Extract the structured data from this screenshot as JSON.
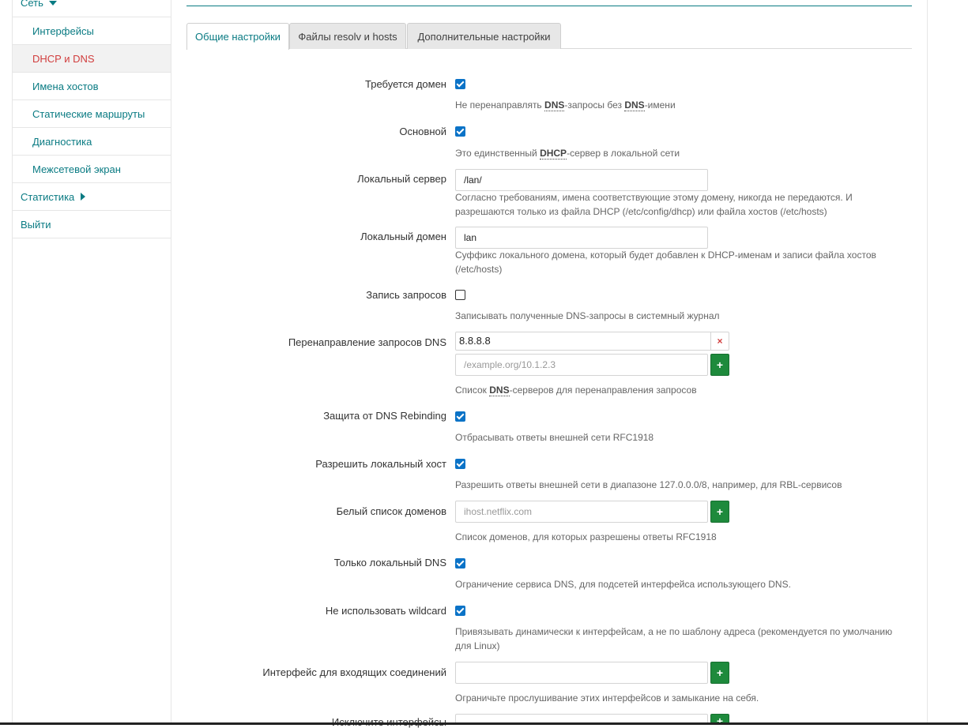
{
  "sidebar": {
    "network": "Сеть",
    "items": [
      {
        "label": "Интерфейсы"
      },
      {
        "label": "DHCP и DNS"
      },
      {
        "label": "Имена хостов"
      },
      {
        "label": "Статические маршруты"
      },
      {
        "label": "Диагностика"
      },
      {
        "label": "Межсетевой экран"
      }
    ],
    "stats": "Статистика",
    "logout": "Выйти"
  },
  "tabs": [
    {
      "label": "Общие настройки"
    },
    {
      "label": "Файлы resolv и hosts"
    },
    {
      "label": "Дополнительные настройки"
    }
  ],
  "form": {
    "domain_required": {
      "label": "Требуется домен",
      "checked": true,
      "desc_pre": "Не перенаправлять ",
      "desc_b1": "DNS",
      "desc_mid": "-запросы без ",
      "desc_b2": "DNS",
      "desc_post": "-имени"
    },
    "authoritative": {
      "label": "Основной",
      "checked": true,
      "desc_pre": "Это единственный ",
      "desc_b": "DHCP",
      "desc_post": "-сервер в локальной сети"
    },
    "local_server": {
      "label": "Локальный сервер",
      "value": "/lan/",
      "desc": "Согласно требованиям, имена соответствующие этому домену, никогда не передаются. И разрешаются только из файла DHCP (/etc/config/dhcp) или файла хостов (/etc/hosts)"
    },
    "local_domain": {
      "label": "Локальный домен",
      "value": "lan",
      "desc": "Суффикс локального домена, который будет добавлен к DHCP-именам и записи файла хостов (/etc/hosts)"
    },
    "log_queries": {
      "label": "Запись запросов",
      "checked": false,
      "desc": "Записывать полученные DNS-запросы в системный журнал"
    },
    "dns_forward": {
      "label": "Перенаправление запросов DNS",
      "value": "8.8.8.8",
      "remove": "×",
      "placeholder": "/example.org/10.1.2.3",
      "add": "+",
      "desc_pre": "Список ",
      "desc_b": "DNS",
      "desc_post": "-серверов для перенаправления запросов"
    },
    "rebind_protection": {
      "label": "Защита от DNS Rebinding",
      "checked": true,
      "desc": "Отбрасывать ответы внешней сети RFC1918"
    },
    "rebind_localhost": {
      "label": "Разрешить локальный хост",
      "checked": true,
      "desc": "Разрешить ответы внешней сети в диапазоне 127.0.0.0/8, например, для RBL-сервисов"
    },
    "rebind_domain": {
      "label": "Белый список доменов",
      "placeholder": "ihost.netflix.com",
      "add": "+",
      "desc": "Список доменов, для которых разрешены ответы RFC1918"
    },
    "local_service": {
      "label": "Только локальный DNS",
      "checked": true,
      "desc": "Ограничение сервиса DNS, для подсетей интерфейса использующего DNS."
    },
    "nonwildcard": {
      "label": "Не использовать wildcard",
      "checked": true,
      "desc": "Привязывать динамически к интерфейсам, а не по шаблону адреса (рекомендуется по умолчанию для Linux)"
    },
    "listen_interface": {
      "label": "Интерфейс для входящих соединений",
      "add": "+",
      "desc": "Ограничьте прослушивание этих интерфейсов и замыкание на себя."
    },
    "exclude_interface": {
      "label": "Исключите интерфейсы",
      "add": "+"
    }
  },
  "colors": {
    "accent": "#0a7b83",
    "active": "#d13d3d",
    "checkbox": "#0b73c7",
    "add_button": "#1e8a3c"
  }
}
